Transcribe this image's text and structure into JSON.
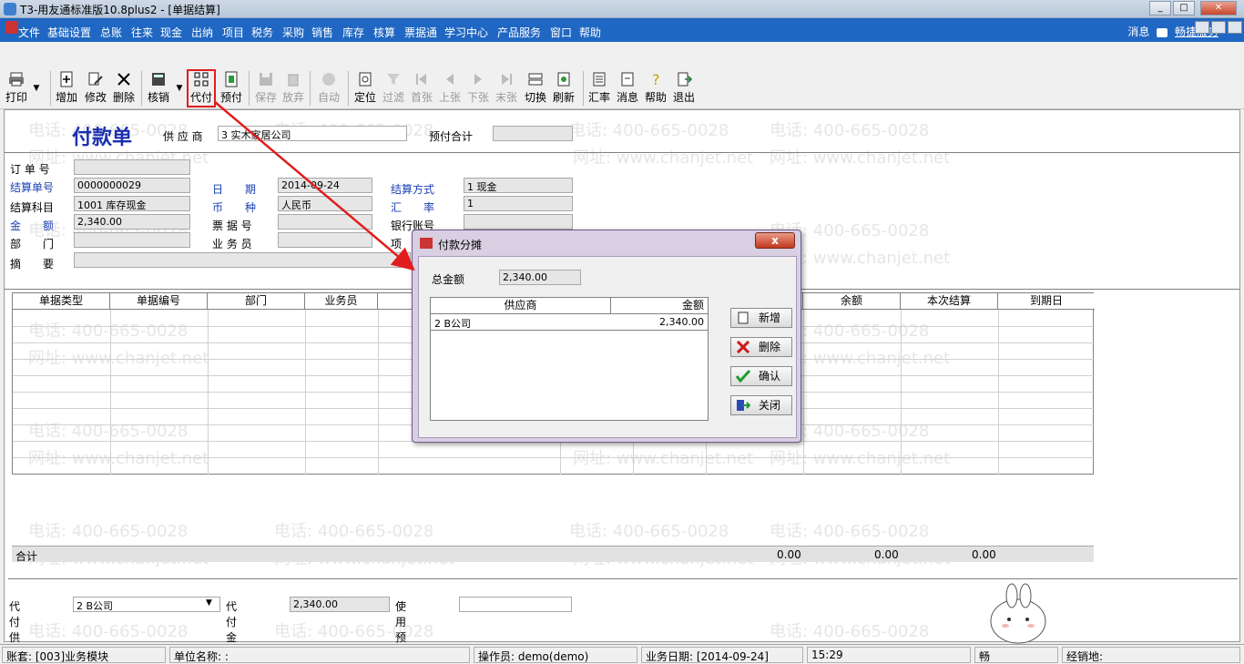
{
  "window": {
    "title": "T3-用友通标准版10.8plus2 - [单据结算]",
    "minimize": "_",
    "maximize": "□",
    "close": "✕"
  },
  "menu": {
    "items": [
      "文件",
      "基础设置",
      "总账",
      "往来",
      "现金",
      "出纳",
      "项目",
      "税务",
      "采购",
      "销售",
      "库存",
      "核算",
      "票据通",
      "学习中心",
      "产品服务",
      "窗口",
      "帮助"
    ],
    "right_msg": "消息",
    "right_service": "畅捷服务"
  },
  "toolbar": {
    "print": "打印",
    "add": "增加",
    "modify": "修改",
    "delete": "删除",
    "writeoff": "核销",
    "proxy_pay": "代付",
    "prepay": "预付",
    "save": "保存",
    "abandon": "放弃",
    "auto": "自动",
    "locate": "定位",
    "filter": "过滤",
    "first": "首张",
    "prev": "上张",
    "next": "下张",
    "last": "末张",
    "switch": "切换",
    "refresh": "刷新",
    "rate": "汇率",
    "message": "消息",
    "help": "帮助",
    "exit": "退出"
  },
  "doc": {
    "title": "付款单",
    "supplier_label": "供 应 商",
    "supplier_value": "3  实木家居公司",
    "prepay_total_label": "预付合计",
    "order_no_label": "订 单 号",
    "settle_no_label": "结算单号",
    "settle_no_value": "0000000029",
    "date_label": "日　　期",
    "date_value": "2014-09-24",
    "settle_method_label": "结算方式",
    "settle_method_value": "1  现金",
    "settle_subject_label": "结算科目",
    "settle_subject_value": "1001  库存现金",
    "currency_label": "币　　种",
    "currency_value": "人民币",
    "rate_label": "汇　　率",
    "rate_value": "1",
    "amount_label": "金　　额",
    "amount_value": "2,340.00",
    "bill_no_label": "票 据 号",
    "bank_account_label": "银行账号",
    "dept_label": "部　　门",
    "salesman_label": "业 务 员",
    "project_label": "项",
    "memo_label": "摘　　要"
  },
  "grid": {
    "headers": [
      "单据类型",
      "单据编号",
      "部门",
      "业务员",
      "",
      "",
      "",
      "",
      "余额",
      "本次结算",
      "到期日"
    ],
    "total_label": "合计",
    "totals": [
      "0.00",
      "0.00",
      "0.00"
    ]
  },
  "bottom": {
    "proxy_supplier_label": "代付供应商",
    "proxy_supplier_value": "2  B公司",
    "proxy_amount_label": "代付金额",
    "proxy_amount_value": "2,340.00",
    "use_prepay_label": "使用预付"
  },
  "dialog": {
    "title": "付款分摊",
    "close": "x",
    "total_label": "总金额",
    "total_value": "2,340.00",
    "col_supplier": "供应商",
    "col_amount": "金额",
    "row_supplier": "2  B公司",
    "row_amount": "2,340.00",
    "btn_add": "新增",
    "btn_delete": "删除",
    "btn_confirm": "确认",
    "btn_close": "关闭"
  },
  "status": {
    "account": "账套: [003]业务模块",
    "unit": "单位名称: :",
    "operator": "操作员: demo(demo)",
    "biz_date": "业务日期: [2014-09-24]",
    "time": "15:29",
    "extra": "畅",
    "dealer": "经销地:"
  },
  "watermark": {
    "phone": "电话: 400-665-0028",
    "site": "网址: www.chanjet.net"
  },
  "colors": {
    "menubar": "#1f67c2",
    "title_blue": "#1a2fb0",
    "highlight_red": "#e21d1d"
  }
}
